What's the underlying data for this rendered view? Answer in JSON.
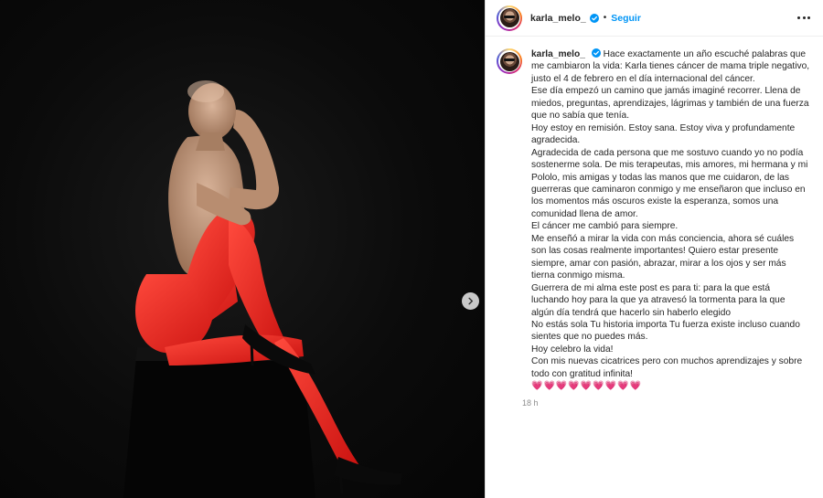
{
  "colors": {
    "accent": "#0095f6",
    "text": "#262626",
    "muted": "#8e8e8e",
    "heart": "#e0245e"
  },
  "post": {
    "username": "karla_melo_",
    "follow_label": "Seguir",
    "separator": "•",
    "time": "18 h",
    "caption": {
      "lines": [
        "Hace exactamente un año escuché palabras que me cambiaron la vida: Karla tienes cáncer de mama triple negativo, justo el 4 de febrero en el día internacional del cáncer.",
        "Ese día empezó un camino que jamás imaginé recorrer. Llena de miedos, preguntas, aprendizajes, lágrimas y también de una fuerza que no sabía que tenía.",
        "Hoy estoy en remisión. Estoy sana. Estoy viva y profundamente agradecida.",
        "Agradecida de cada persona que me sostuvo cuando yo no podía sostenerme sola. De mis terapeutas, mis amores, mi hermana y mi Pololo, mis amigas y todas las manos que me cuidaron, de las guerreras que caminaron conmigo y me enseñaron que incluso en los momentos más oscuros existe la esperanza, somos una comunidad llena de amor.",
        "El cáncer me cambió para siempre.",
        "Me enseñó a mirar la vida con más conciencia, ahora sé cuáles son las cosas realmente importantes! Quiero estar presente siempre, amar con pasión, abrazar, mirar a los ojos y ser más tierna conmigo misma.",
        "Guerrera de mi alma este post es para ti: para la que está luchando hoy para la que ya atravesó la tormenta para la que algún día tendrá que hacerlo sin haberlo elegido",
        "No estás sola Tu historia importa Tu fuerza existe incluso cuando sientes que no puedes más.",
        "Hoy celebro la vida!",
        "Con mis nuevas cicatrices pero con muchos aprendizajes y sobre todo con gratitud infinita!"
      ],
      "hearts": "💗💗💗💗💗💗💗💗💗"
    }
  },
  "icons": {
    "verified": "verified-badge-icon",
    "more": "more-options-icon",
    "next": "chevron-right-icon"
  }
}
